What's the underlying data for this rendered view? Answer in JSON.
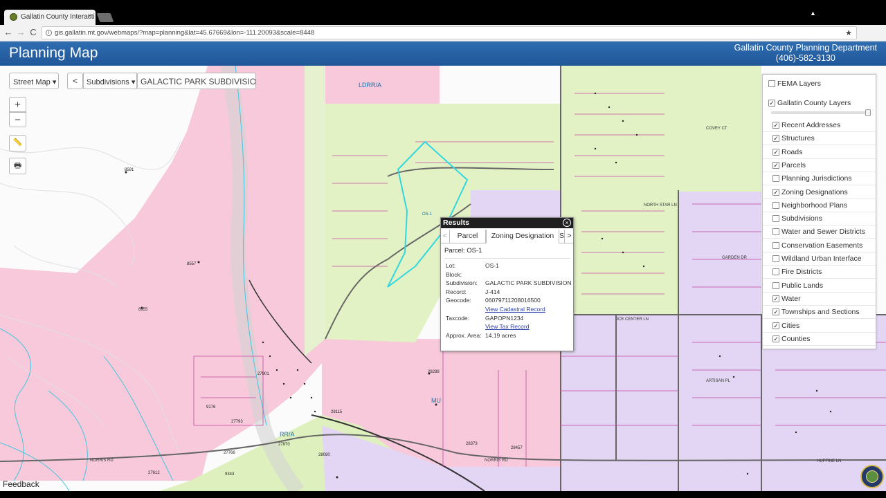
{
  "browser": {
    "tab_title": "Gallatin County Interacti",
    "tab_close": "×",
    "back": "←",
    "forward": "→",
    "reload": "C",
    "info": "i",
    "url": "gis.gallatin.mt.gov/webmaps/?map=planning&lat=45.67669&lon=-111.20093&scale=8448",
    "bookmark": "★",
    "user": "▲"
  },
  "header": {
    "title": "Planning Map",
    "department": "Gallatin County Planning Department",
    "phone": "(406)-582-3130"
  },
  "map_controls": {
    "basemap": "Street Map ▾",
    "back_button": "<",
    "search_type": "Subdivisions ▾",
    "search_value": "GALACTIC PARK SUBDIVISION",
    "zoom_in": "+",
    "zoom_out": "−",
    "measure": "📏",
    "print": "🖶",
    "feedback": "Feedback"
  },
  "results": {
    "title": "Results",
    "close": "×",
    "tab_prev": "<",
    "tab_next": ">",
    "tabs": [
      "Parcel",
      "Zoning Designation",
      "S"
    ],
    "heading": "Parcel: OS-1",
    "rows": [
      {
        "k": "Lot:",
        "v": "OS-1"
      },
      {
        "k": "Block:",
        "v": ""
      },
      {
        "k": "Subdivision:",
        "v": "GALACTIC PARK SUBDIVISION"
      },
      {
        "k": "Record:",
        "v": "J-414"
      },
      {
        "k": "Geocode:",
        "v": "06079711208016500"
      },
      {
        "k": "",
        "v": "View Cadastral Record",
        "link": true
      },
      {
        "k": "Taxcode:",
        "v": "GAPOPN1234"
      },
      {
        "k": "",
        "v": "View Tax Record",
        "link": true
      },
      {
        "k": "Approx. Area:",
        "v": "14.19 acres"
      }
    ]
  },
  "layers": {
    "top": [
      {
        "label": "FEMA Layers",
        "checked": false
      },
      {
        "label": "Gallatin County Layers",
        "checked": true
      }
    ],
    "items": [
      {
        "label": "Recent Addresses",
        "checked": true
      },
      {
        "label": "Structures",
        "checked": true
      },
      {
        "label": "Roads",
        "checked": true
      },
      {
        "label": "Parcels",
        "checked": true
      },
      {
        "label": "Planning Jurisdictions",
        "checked": false
      },
      {
        "label": "Zoning Designations",
        "checked": true
      },
      {
        "label": "Neighborhood Plans",
        "checked": false
      },
      {
        "label": "Subdivisions",
        "checked": false
      },
      {
        "label": "Water and Sewer Districts",
        "checked": false
      },
      {
        "label": "Conservation Easements",
        "checked": false
      },
      {
        "label": "Wildland Urban Interface",
        "checked": false
      },
      {
        "label": "Fire Districts",
        "checked": false
      },
      {
        "label": "Public Lands",
        "checked": false
      },
      {
        "label": "Water",
        "checked": true
      },
      {
        "label": "Townships and Sections",
        "checked": true
      },
      {
        "label": "Cities",
        "checked": true
      },
      {
        "label": "Counties",
        "checked": true
      }
    ],
    "check_glyph": "✓"
  },
  "map_labels": {
    "zones": [
      "LDRR/A",
      "RR/A",
      "MU",
      "OS-1"
    ],
    "roads": [
      "NORRIS RD",
      "NORRIS RD",
      "NORTH STAR LN",
      "GARDEN DR",
      "JCE CENTER LN",
      "ARTISAN PL",
      "HUFFINE LN",
      "COVEY CT"
    ],
    "numbers": [
      "8591",
      "8557",
      "8955",
      "27901",
      "27793",
      "28115",
      "28289",
      "28373",
      "28457",
      "27970",
      "28080",
      "27766",
      "27612",
      "9343",
      "9176"
    ]
  },
  "colors": {
    "header_blue": "#2a64a8",
    "zone_pink": "#f7c9da",
    "zone_green": "#e3f2c4",
    "zone_lavender": "#e3d6f4",
    "parcel_line": "#c447a0",
    "highlight_cyan": "#31d6e0"
  }
}
